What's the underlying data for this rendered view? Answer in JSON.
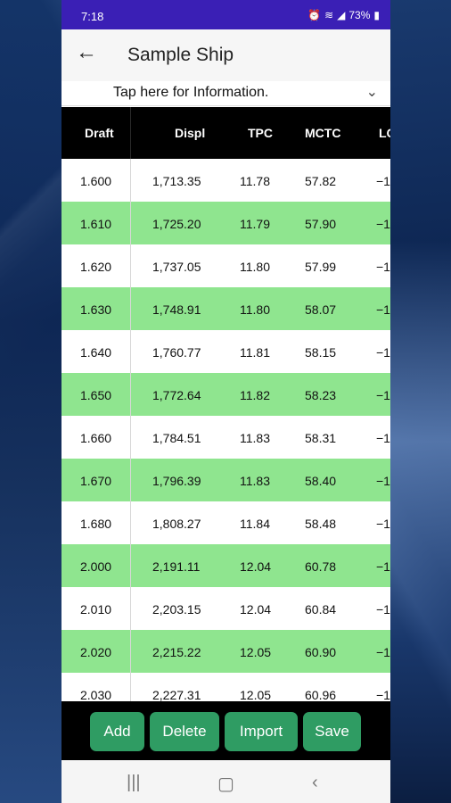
{
  "status_bar": {
    "time": "7:18",
    "battery": "73%"
  },
  "app_bar": {
    "title": "Sample Ship"
  },
  "info": {
    "text": "Tap here for Information."
  },
  "table": {
    "headers": [
      "Draft",
      "Displ",
      "TPC",
      "MCTC",
      "LC"
    ],
    "rows": [
      [
        "1.600",
        "1,713.35",
        "11.78",
        "57.82",
        "−1"
      ],
      [
        "1.610",
        "1,725.20",
        "11.79",
        "57.90",
        "−1"
      ],
      [
        "1.620",
        "1,737.05",
        "11.80",
        "57.99",
        "−1"
      ],
      [
        "1.630",
        "1,748.91",
        "11.80",
        "58.07",
        "−1"
      ],
      [
        "1.640",
        "1,760.77",
        "11.81",
        "58.15",
        "−1"
      ],
      [
        "1.650",
        "1,772.64",
        "11.82",
        "58.23",
        "−1"
      ],
      [
        "1.660",
        "1,784.51",
        "11.83",
        "58.31",
        "−1"
      ],
      [
        "1.670",
        "1,796.39",
        "11.83",
        "58.40",
        "−1"
      ],
      [
        "1.680",
        "1,808.27",
        "11.84",
        "58.48",
        "−1"
      ],
      [
        "2.000",
        "2,191.11",
        "12.04",
        "60.78",
        "−1"
      ],
      [
        "2.010",
        "2,203.15",
        "12.04",
        "60.84",
        "−1"
      ],
      [
        "2.020",
        "2,215.22",
        "12.05",
        "60.90",
        "−1"
      ],
      [
        "2.030",
        "2,227.31",
        "12.05",
        "60.96",
        "−1"
      ]
    ]
  },
  "buttons": {
    "add": "Add",
    "delete": "Delete",
    "import": "Import",
    "save": "Save"
  },
  "colors": {
    "status_bar": "#3a1fb5",
    "row_highlight": "#8fe58f",
    "button": "#2f9c63"
  }
}
